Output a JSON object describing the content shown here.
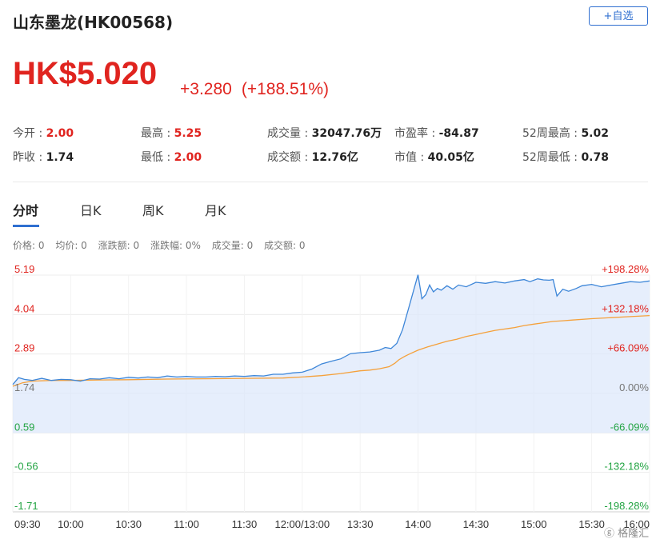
{
  "header": {
    "title": "山东墨龙(HK00568)",
    "add_watchlist": "+自选"
  },
  "quote": {
    "price": "HK$5.020",
    "change": "+3.280",
    "change_pct": "(+188.51%)"
  },
  "stats": [
    {
      "label": "今开 : ",
      "value": "2.00",
      "red": true
    },
    {
      "label": "最高 : ",
      "value": "5.25",
      "red": true
    },
    {
      "label": "成交量 : ",
      "value": "32047.76万",
      "red": false
    },
    {
      "label": "市盈率 : ",
      "value": "-84.87",
      "red": false
    },
    {
      "label": "52周最高 : ",
      "value": "5.02",
      "red": false
    },
    {
      "label": "昨收 : ",
      "value": "1.74",
      "red": false
    },
    {
      "label": "最低 : ",
      "value": "2.00",
      "red": true
    },
    {
      "label": "成交额 : ",
      "value": "12.76亿",
      "red": false
    },
    {
      "label": "市值 : ",
      "value": "40.05亿",
      "red": false
    },
    {
      "label": "52周最低 : ",
      "value": "0.78",
      "red": false
    }
  ],
  "tabs": [
    "分时",
    "日K",
    "周K",
    "月K"
  ],
  "info_bar": [
    "价格: 0",
    "均价: 0",
    "涨跌额: 0",
    "涨跌幅: 0%",
    "成交量: 0",
    "成交额: 0"
  ],
  "watermark": "格隆汇",
  "colors": {
    "up": "#e0241f",
    "down": "#23a443",
    "price_line": "#3d86d8",
    "avg_line": "#f5a03a",
    "accent": "#2f6fd0"
  },
  "chart_data": {
    "type": "line",
    "y_left_ticks": [
      "5.19",
      "4.04",
      "2.89",
      "1.74",
      "0.59",
      "-0.56",
      "-1.71"
    ],
    "y_right_ticks": [
      "+198.28%",
      "+132.18%",
      "+66.09%",
      "0.00%",
      "-66.09%",
      "-132.18%",
      "-198.28%"
    ],
    "x_ticks": [
      "09:30",
      "10:00",
      "10:30",
      "11:00",
      "11:30",
      "12:00/13:00",
      "13:30",
      "14:00",
      "14:30",
      "15:00",
      "15:30",
      "16:00"
    ],
    "ylim": [
      -1.71,
      5.19
    ],
    "prev_close": 1.74,
    "x_range": [
      0,
      330
    ],
    "series": [
      {
        "name": "",
        "x": [
          0,
          3,
          6,
          10,
          15,
          20,
          25,
          30,
          35,
          40,
          45,
          50,
          55,
          60,
          65,
          70,
          75,
          80,
          85,
          90,
          95,
          100,
          105,
          110,
          115,
          120,
          125,
          130,
          135,
          140,
          145,
          150,
          155,
          160,
          165,
          170,
          175,
          180,
          185,
          190,
          193,
          196,
          199,
          202,
          205,
          208,
          210,
          212,
          214,
          216,
          218,
          220,
          222,
          225,
          228,
          231,
          235,
          240,
          245,
          250,
          255,
          260,
          265,
          268,
          272,
          275,
          278,
          280,
          282,
          285,
          288,
          292,
          295,
          300,
          305,
          310,
          315,
          320,
          325,
          330
        ],
        "values": [
          2.0,
          2.2,
          2.15,
          2.12,
          2.18,
          2.12,
          2.15,
          2.14,
          2.1,
          2.17,
          2.16,
          2.2,
          2.17,
          2.21,
          2.19,
          2.22,
          2.2,
          2.25,
          2.22,
          2.24,
          2.22,
          2.22,
          2.24,
          2.23,
          2.25,
          2.24,
          2.26,
          2.25,
          2.3,
          2.3,
          2.34,
          2.36,
          2.45,
          2.6,
          2.68,
          2.75,
          2.9,
          2.93,
          2.95,
          3.0,
          3.08,
          3.05,
          3.2,
          3.6,
          4.2,
          4.8,
          5.2,
          4.5,
          4.62,
          4.9,
          4.7,
          4.8,
          4.75,
          4.88,
          4.78,
          4.9,
          4.85,
          4.98,
          4.95,
          5.0,
          4.96,
          5.02,
          5.06,
          5.0,
          5.08,
          5.05,
          5.04,
          5.06,
          4.58,
          4.78,
          4.72,
          4.8,
          4.88,
          4.92,
          4.85,
          4.9,
          4.95,
          5.0,
          4.98,
          5.02
        ]
      },
      {
        "name": "",
        "x": [
          0,
          5,
          10,
          20,
          30,
          40,
          60,
          80,
          100,
          120,
          140,
          150,
          160,
          170,
          180,
          185,
          190,
          195,
          198,
          200,
          203,
          206,
          210,
          215,
          220,
          225,
          230,
          235,
          240,
          245,
          250,
          255,
          260,
          265,
          270,
          275,
          280,
          285,
          290,
          300,
          310,
          320,
          330
        ],
        "values": [
          1.95,
          2.05,
          2.1,
          2.12,
          2.12,
          2.13,
          2.14,
          2.16,
          2.17,
          2.18,
          2.19,
          2.22,
          2.26,
          2.32,
          2.4,
          2.42,
          2.46,
          2.52,
          2.62,
          2.72,
          2.82,
          2.9,
          3.0,
          3.1,
          3.18,
          3.26,
          3.32,
          3.4,
          3.46,
          3.52,
          3.58,
          3.62,
          3.66,
          3.72,
          3.76,
          3.8,
          3.84,
          3.86,
          3.88,
          3.92,
          3.95,
          3.98,
          4.01
        ]
      }
    ]
  }
}
